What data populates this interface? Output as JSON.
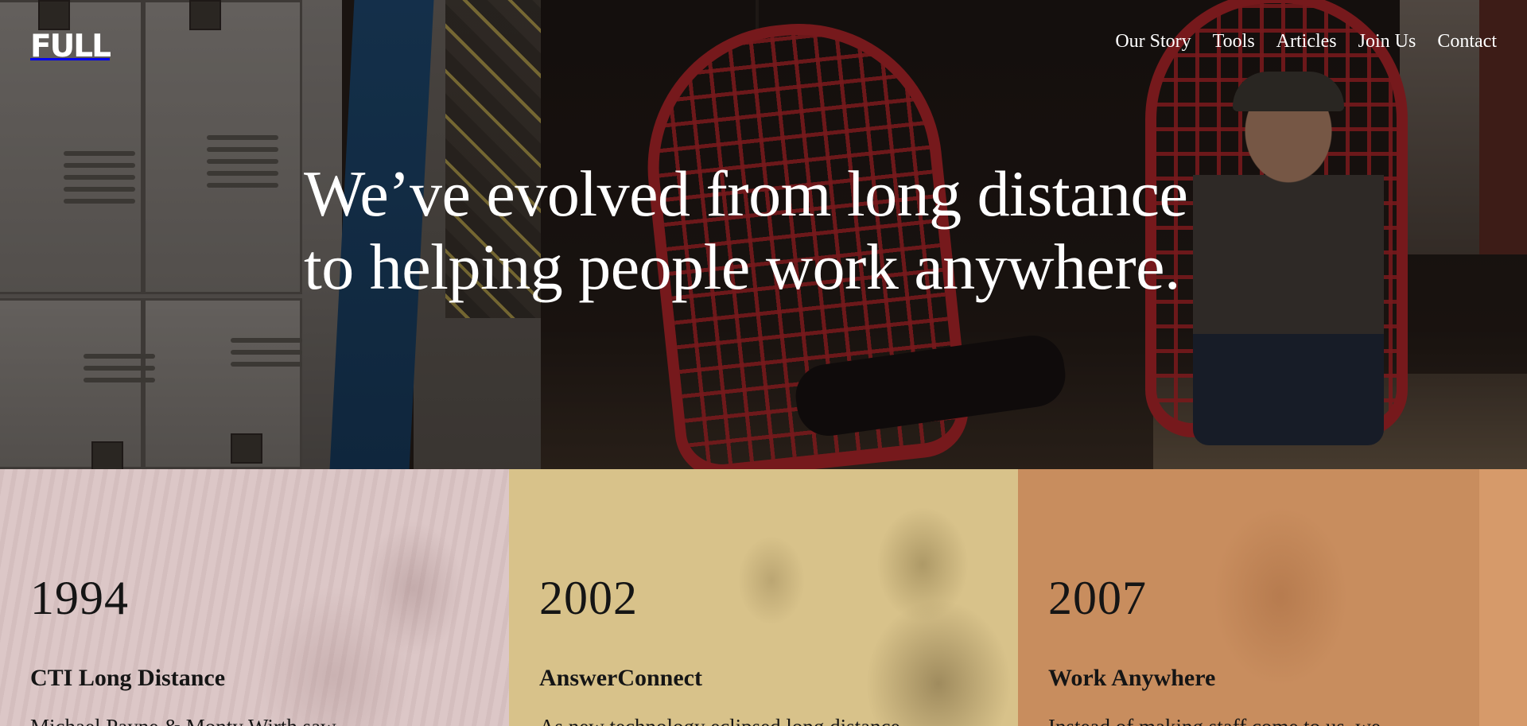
{
  "brand": {
    "logo_text": "FULL"
  },
  "nav": {
    "items": [
      {
        "label": "Our Story"
      },
      {
        "label": "Tools"
      },
      {
        "label": "Articles"
      },
      {
        "label": "Join Us"
      },
      {
        "label": "Contact"
      }
    ]
  },
  "hero": {
    "headline_line1": "We’ve evolved from long distance",
    "headline_line2": "to helping people work anywhere."
  },
  "timeline": [
    {
      "year": "1994",
      "title": "CTI Long Distance",
      "text": "Michael Payne & Monty Wirth saw",
      "color": "#dcc7c7"
    },
    {
      "year": "2002",
      "title": "AnswerConnect",
      "text": "As new technology eclipsed long distance",
      "color": "#d8c28a"
    },
    {
      "year": "2007",
      "title": "Work Anywhere",
      "text": "Instead of making staff come to us, we",
      "color": "#c88d5e"
    }
  ],
  "colors": {
    "text_light": "#ffffff",
    "text_dark": "#151515",
    "chair_red": "#b8262a"
  }
}
